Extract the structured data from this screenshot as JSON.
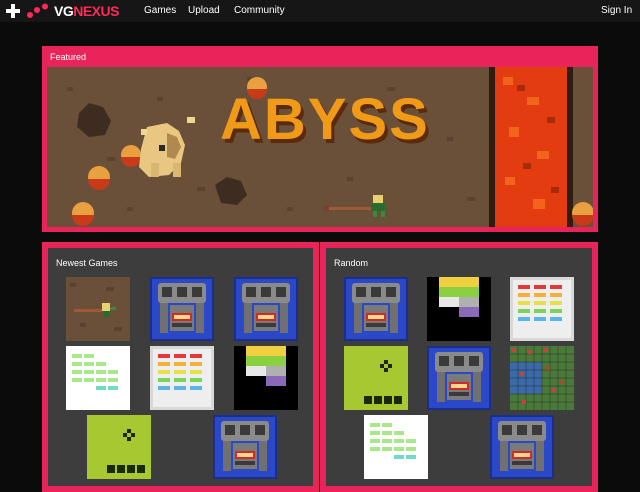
{
  "header": {
    "logo_part1": "VG",
    "logo_part2": "NEXUS",
    "nav": [
      "Games",
      "Upload",
      "Community"
    ],
    "sign_in": "Sign In"
  },
  "featured": {
    "title": "Featured",
    "game_title": "ABYSS"
  },
  "newest": {
    "title": "Newest Games",
    "thumbs": [
      "abyss-thumb",
      "robot-thumb",
      "robot-thumb",
      "breakout-white-thumb",
      "breakout-gray-thumb",
      "breakout-black-thumb",
      "snake-thumb",
      "robot-thumb"
    ]
  },
  "random": {
    "title": "Random",
    "thumbs": [
      "robot-thumb",
      "breakout-black-thumb",
      "breakout-gray-thumb",
      "snake-thumb",
      "robot-thumb",
      "strategy-map-thumb",
      "breakout-white-thumb",
      "robot-thumb"
    ]
  },
  "colors": {
    "accent": "#e8245a",
    "topbar": "#161616",
    "panel": "#3d3d3d",
    "lava": "#e23c10",
    "dirt": "#6b5039"
  }
}
